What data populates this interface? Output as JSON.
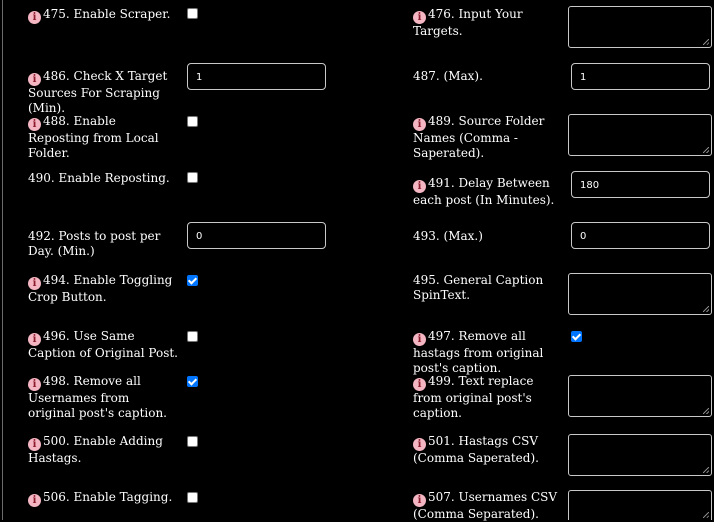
{
  "rows": [
    {
      "left": {
        "label": "475. Enable Scraper.",
        "info": true,
        "control": "checkbox",
        "checked": false
      },
      "right": {
        "label": "476. Input Your Targets.",
        "info": true,
        "control": "textarea",
        "value": ""
      }
    },
    {
      "left": {
        "label": "486. Check X Target Sources For Scraping (Min).",
        "info": true,
        "control": "input",
        "value": "1"
      },
      "right": {
        "label": "487. (Max).",
        "info": false,
        "control": "input",
        "value": "1"
      }
    },
    {
      "left": {
        "label": "488. Enable Reposting from Local Folder.",
        "info": true,
        "control": "checkbox",
        "checked": false
      },
      "right": {
        "label": "489. Source Folder Names (Comma - Saperated).",
        "info": true,
        "control": "textarea",
        "value": ""
      }
    },
    {
      "left": {
        "label": "490. Enable Reposting.",
        "info": false,
        "control": "checkbox",
        "checked": false
      },
      "right": {
        "label": "491. Delay Between each post (In Minutes).",
        "info": true,
        "control": "input",
        "value": "180"
      }
    },
    {
      "left": {
        "label": "492. Posts to post per Day. (Min.)",
        "info": false,
        "control": "input",
        "value": "0"
      },
      "right": {
        "label": "493. (Max.)",
        "info": false,
        "control": "input",
        "value": "0"
      }
    },
    {
      "left": {
        "label": "494. Enable Toggling Crop Button.",
        "info": true,
        "control": "checkbox",
        "checked": true
      },
      "right": {
        "label": "495. General Caption SpinText.",
        "info": false,
        "control": "textarea",
        "value": ""
      }
    },
    {
      "left": {
        "label": "496. Use Same Caption of Original Post.",
        "info": true,
        "control": "checkbox",
        "checked": false
      },
      "right": {
        "label": "497. Remove all hastags from original post's caption.",
        "info": true,
        "control": "checkbox",
        "checked": true
      }
    },
    {
      "left": {
        "label": "498. Remove all Usernames from original post's caption.",
        "info": true,
        "control": "checkbox",
        "checked": true
      },
      "right": {
        "label": "499. Text replace from original post's caption.",
        "info": true,
        "control": "textarea",
        "value": ""
      }
    },
    {
      "left": {
        "label": "500. Enable Adding Hastags.",
        "info": true,
        "control": "checkbox",
        "checked": false
      },
      "right": {
        "label": "501. Hastags CSV (Comma Saperated).",
        "info": true,
        "control": "textarea",
        "value": ""
      }
    },
    {
      "left": {
        "label": "506. Enable Tagging.",
        "info": true,
        "control": "checkbox",
        "checked": false
      },
      "right": {
        "label": "507. Usernames CSV (Comma Separated).",
        "info": true,
        "control": "textarea",
        "value": ""
      }
    }
  ]
}
